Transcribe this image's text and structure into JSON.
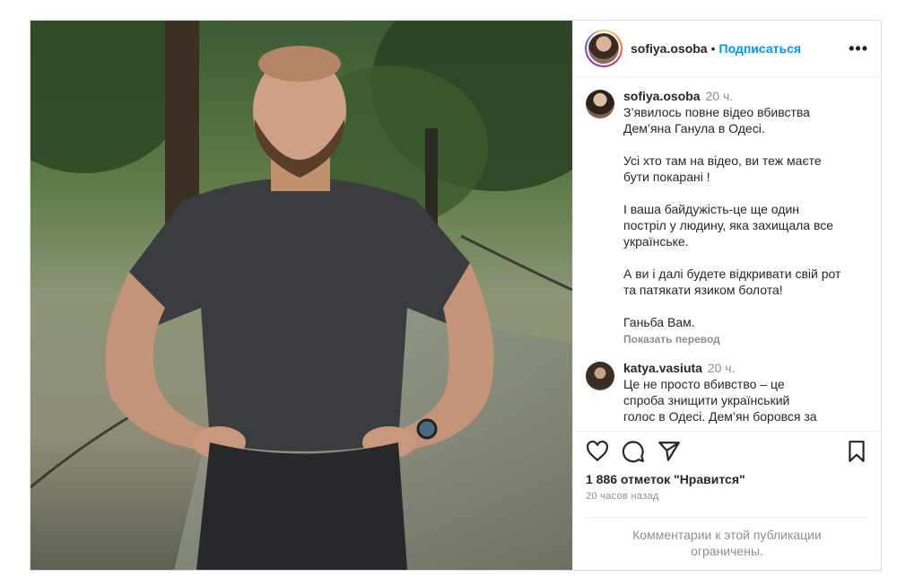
{
  "header": {
    "username": "sofiya.osoba",
    "separator": "•",
    "follow_label": "Подписаться",
    "more_label": "•••"
  },
  "comments": [
    {
      "username": "sofiya.osoba",
      "time": "20 ч.",
      "text": "З’явилось повне відео вбивства\nДем’яна Ганула в Одесі.\n\nУсі хто там на відео, ви теж маєте\nбути покарані !\n\nІ ваша байдужість-це ще один\nпостріл у людину, яка захищала все\nукраїнське.\n\nА ви і далі будете відкривати свій рот\nта патякати язиком болота!\n\nГаньба Вам.",
      "translate": "Показать перевод"
    },
    {
      "username": "katya.vasiuta",
      "time": "20 ч.",
      "text": "Це не просто вбивство – це\nспроба знищити український\nголос в Одесі. Дем’ян боровся за"
    }
  ],
  "actions": {
    "like_icon": "heart-icon",
    "comment_icon": "comment-icon",
    "share_icon": "share-icon",
    "save_icon": "bookmark-icon"
  },
  "likes_text": "1 886 отметок \"Нравится\"",
  "time_ago": "20 часов назад",
  "comments_restricted": "Комментарии к этой публикации\nограничены.",
  "colors": {
    "accent": "#0095f6",
    "text": "#262626",
    "muted": "#8e8e8e",
    "border": "#dbdbdb"
  }
}
